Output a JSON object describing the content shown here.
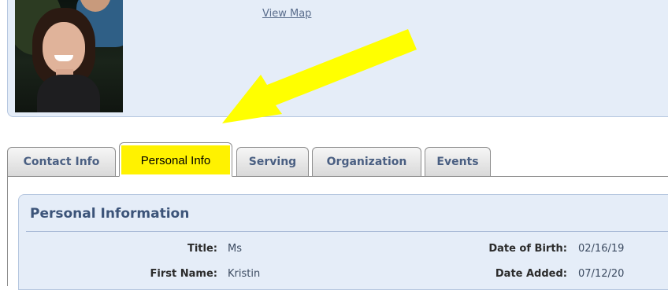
{
  "header": {
    "view_map_label": "View Map"
  },
  "tabs": [
    {
      "label": "Contact Info"
    },
    {
      "label": "Personal Info",
      "active": true
    },
    {
      "label": "Serving"
    },
    {
      "label": "Organization"
    },
    {
      "label": "Events"
    }
  ],
  "personal_section": {
    "title": "Personal Information",
    "left_fields": [
      {
        "label": "Title:",
        "value": "Ms"
      },
      {
        "label": "First Name:",
        "value": "Kristin"
      }
    ],
    "right_fields": [
      {
        "label": "Date of Birth:",
        "value": "02/16/19"
      },
      {
        "label": "Date Added:",
        "value": "07/12/20"
      }
    ]
  },
  "colors": {
    "highlight": "#fff200",
    "accent": "#3c5479",
    "panel_bg": "#e5edf8"
  }
}
